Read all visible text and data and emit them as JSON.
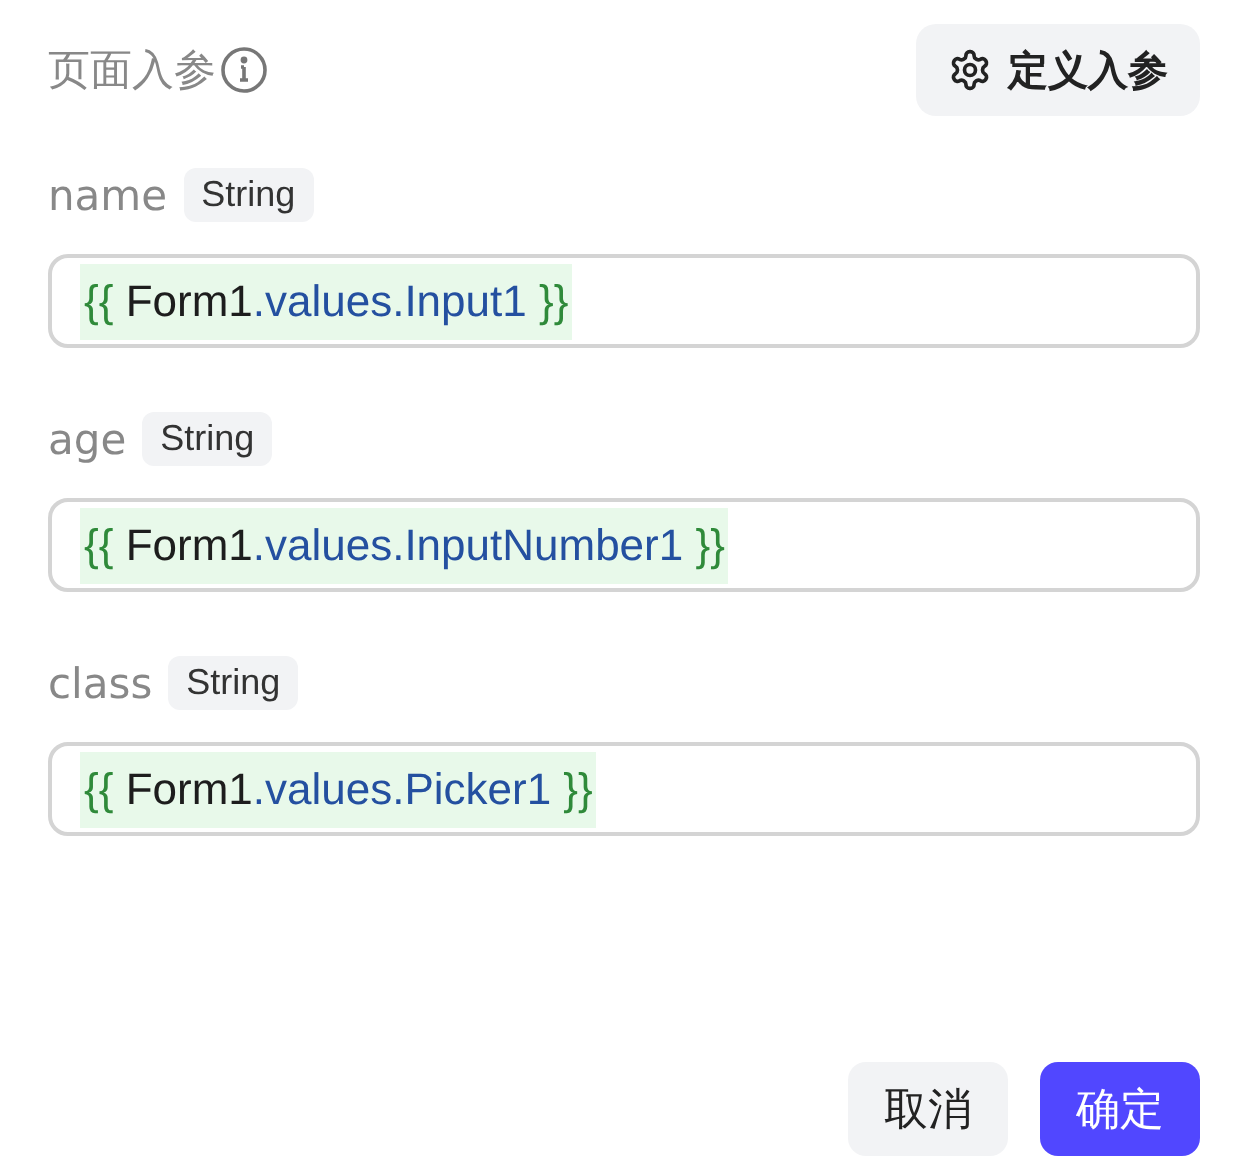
{
  "header": {
    "title": "页面入参",
    "define_button": "定义入参"
  },
  "params": [
    {
      "name": "name",
      "type": "String",
      "value": [
        {
          "kind": "brace",
          "text": "{{ "
        },
        {
          "kind": "object",
          "text": "Form1"
        },
        {
          "kind": "path",
          "text": ".values.Input1"
        },
        {
          "kind": "brace",
          "text": " }}"
        }
      ]
    },
    {
      "name": "age",
      "type": "String",
      "value": [
        {
          "kind": "brace",
          "text": "{{ "
        },
        {
          "kind": "object",
          "text": "Form1"
        },
        {
          "kind": "path",
          "text": ".values.InputNumber1"
        },
        {
          "kind": "brace",
          "text": " }}"
        }
      ]
    },
    {
      "name": "class",
      "type": "String",
      "value": [
        {
          "kind": "brace",
          "text": "{{ "
        },
        {
          "kind": "object",
          "text": "Form1"
        },
        {
          "kind": "path",
          "text": ".values.Picker1"
        },
        {
          "kind": "brace",
          "text": " }}"
        }
      ]
    }
  ],
  "footer": {
    "cancel": "取消",
    "confirm": "确定"
  }
}
